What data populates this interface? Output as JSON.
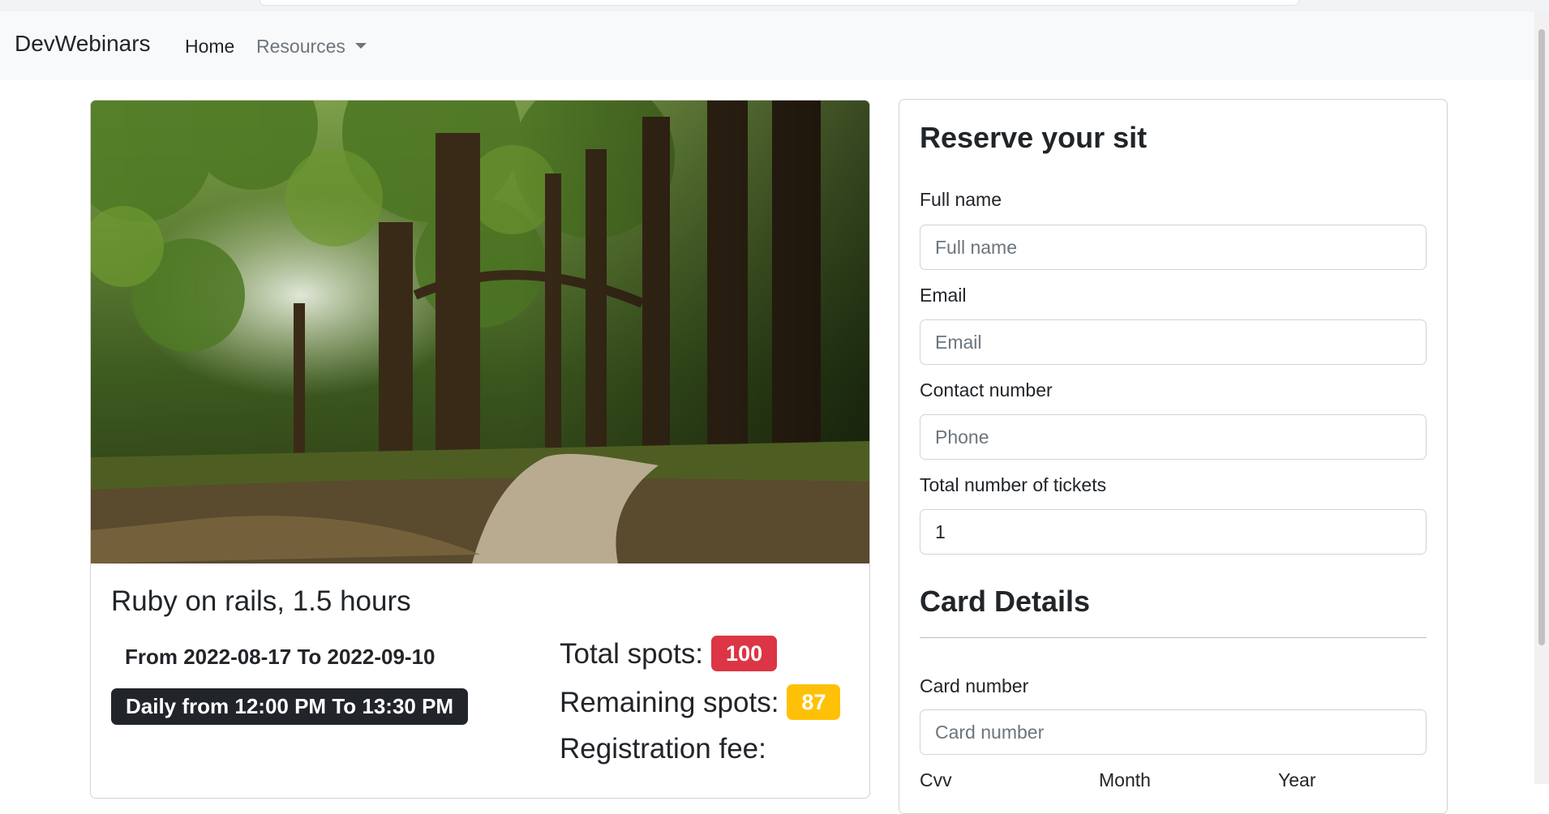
{
  "navbar": {
    "brand": "DevWebinars",
    "links": [
      {
        "label": "Home"
      },
      {
        "label": "Resources"
      }
    ]
  },
  "event": {
    "title": "Ruby on rails, 1.5 hours",
    "dates": "From 2022-08-17 To 2022-09-10",
    "daily_time": "Daily from 12:00 PM To 13:30 PM",
    "total_spots_label": "Total spots:",
    "total_spots": "100",
    "remaining_spots_label": "Remaining spots:",
    "remaining_spots": "87",
    "fee_label": "Registration fee:"
  },
  "form": {
    "title": "Reserve your sit",
    "fields": {
      "full_name": {
        "label": "Full name",
        "placeholder": "Full name",
        "value": ""
      },
      "email": {
        "label": "Email",
        "placeholder": "Email",
        "value": ""
      },
      "contact": {
        "label": "Contact number",
        "placeholder": "Phone",
        "value": ""
      },
      "tickets": {
        "label": "Total number of tickets",
        "placeholder": "",
        "value": "1"
      }
    },
    "card_section_title": "Card Details",
    "card": {
      "number": {
        "label": "Card number",
        "placeholder": "Card number",
        "value": ""
      },
      "cvv_label": "Cvv",
      "month_label": "Month",
      "year_label": "Year"
    }
  },
  "colors": {
    "navbar_bg": "#f8f9fa",
    "danger": "#dc3545",
    "warning": "#ffc107",
    "dark": "#212529"
  }
}
